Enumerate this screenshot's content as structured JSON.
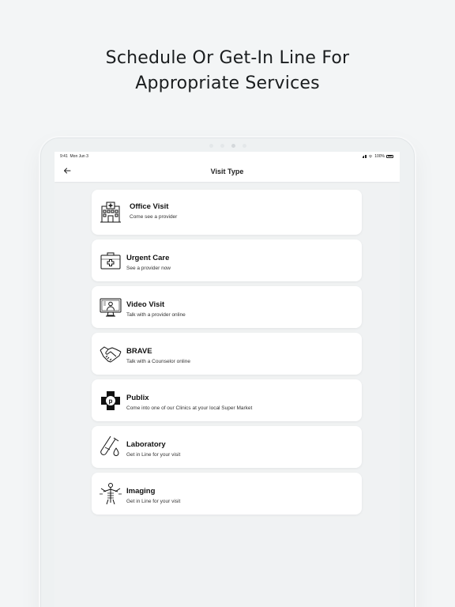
{
  "headline": {
    "line1": "Schedule Or Get-In Line For",
    "line2": "Appropriate Services"
  },
  "status": {
    "time": "9:41",
    "date": "Mon Jun 3",
    "battery": "100%"
  },
  "nav": {
    "back_icon": "arrow-left-icon",
    "title": "Visit Type"
  },
  "services": [
    {
      "title": "Office Visit",
      "subtitle": "Come see a provider",
      "icon": "hospital-icon"
    },
    {
      "title": "Urgent Care",
      "subtitle": "See a provider now",
      "icon": "medical-kit-icon"
    },
    {
      "title": "Video Visit",
      "subtitle": "Talk with a provider online",
      "icon": "video-monitor-icon"
    },
    {
      "title": "BRAVE",
      "subtitle": "Talk with a Counselor online",
      "icon": "handshake-icon"
    },
    {
      "title": "Publix",
      "subtitle": "Come into one of our Clinics at your local Super Market",
      "icon": "publix-cross-icon"
    },
    {
      "title": "Laboratory",
      "subtitle": "Get in Line for your visit",
      "icon": "test-tube-icon"
    },
    {
      "title": "Imaging",
      "subtitle": "Get in Line for your visit",
      "icon": "xray-body-icon"
    }
  ],
  "colors": {
    "background": "#f3f5f6",
    "card": "#ffffff",
    "text": "#111111"
  }
}
